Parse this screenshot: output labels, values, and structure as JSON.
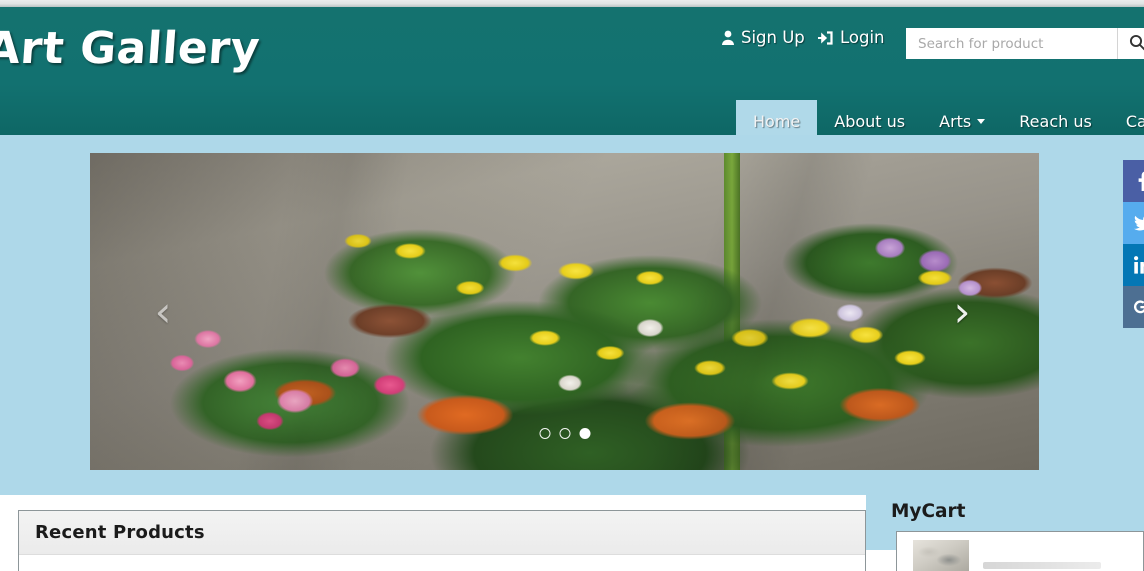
{
  "site": {
    "logo_text": "Art Gallery",
    "brand_teal": "#13706e",
    "body_blue": "#aed8e9",
    "active_tab_blue": "#b0d9e9"
  },
  "header": {
    "account": {
      "signup_label": "Sign Up",
      "signup_icon": "user-icon",
      "login_label": "Login",
      "login_icon": "login-arrow-icon"
    },
    "search": {
      "placeholder": "Search for product",
      "value": "",
      "button_icon": "search-icon"
    }
  },
  "nav": {
    "items": [
      {
        "label": "Home",
        "active": true,
        "has_caret": false
      },
      {
        "label": "About us",
        "active": false,
        "has_caret": false
      },
      {
        "label": "Arts",
        "active": false,
        "has_caret": true
      },
      {
        "label": "Reach us",
        "active": false,
        "has_caret": false
      },
      {
        "label": "Cart us",
        "active": false,
        "has_caret": false
      }
    ]
  },
  "carousel": {
    "prev_icon": "chevron-left-icon",
    "next_icon": "chevron-right-icon",
    "prev_glyph": "‹",
    "next_glyph": "›",
    "slide_alt": "Garden of potted yellow marigolds and pink petunias on pavement",
    "indicators": [
      {
        "active": false
      },
      {
        "active": false
      },
      {
        "active": true
      }
    ]
  },
  "social": {
    "items": [
      {
        "name": "facebook",
        "glyph": "f",
        "color": "#4a5fa5"
      },
      {
        "name": "twitter",
        "glyph": "ᴠ",
        "color": "#56acee"
      },
      {
        "name": "linkedin",
        "glyph": "in",
        "color": "#0477b5"
      },
      {
        "name": "google",
        "glyph": "□",
        "color": "#4d6f92"
      }
    ]
  },
  "recent_products": {
    "title": "Recent Products"
  },
  "mycart": {
    "title": "MyCart",
    "item_thumb_icon": "product-thumbnail"
  }
}
